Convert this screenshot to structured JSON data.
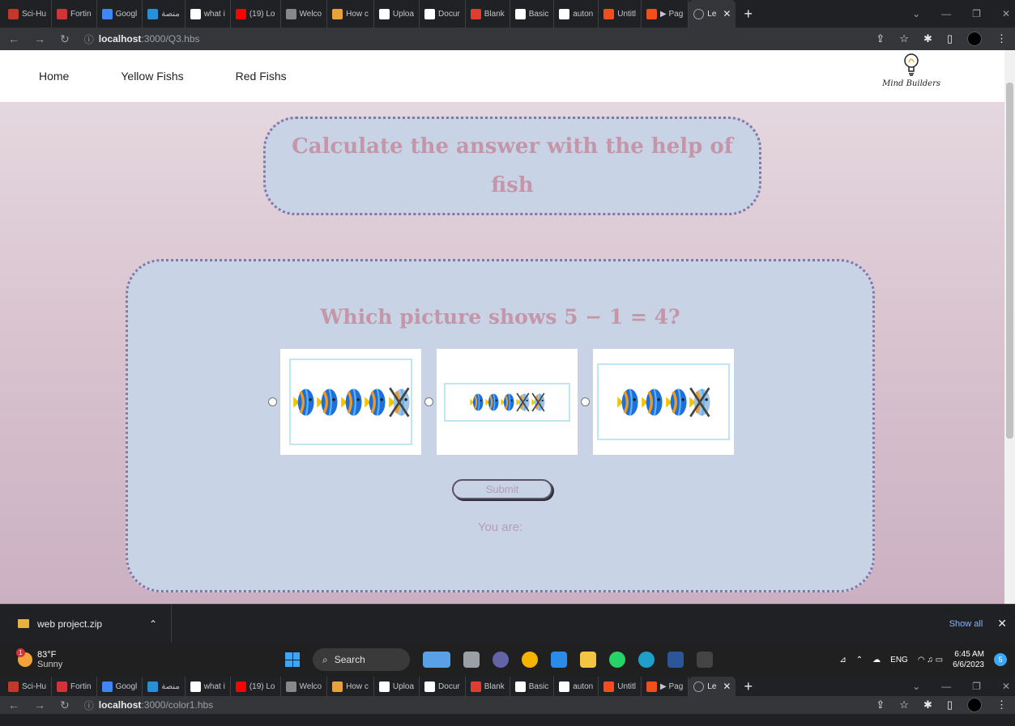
{
  "browser": {
    "tabs": [
      {
        "label": "Sci-Hu",
        "color": "#c0392b"
      },
      {
        "label": "Fortin",
        "color": "#d13438"
      },
      {
        "label": "Googl",
        "color": "#4285f4"
      },
      {
        "label": "منصة",
        "color": "#2b8fd6"
      },
      {
        "label": "what i",
        "color": "#ffffff"
      },
      {
        "label": "(19) Lo",
        "color": "#ff0000"
      },
      {
        "label": "Welco",
        "color": "#888888"
      },
      {
        "label": "How c",
        "color": "#e6a23c"
      },
      {
        "label": "Uploa",
        "color": "#ffffff"
      },
      {
        "label": "Docur",
        "color": "#ffffff"
      },
      {
        "label": "Blank",
        "color": "#e03c31"
      },
      {
        "label": "Basic",
        "color": "#ffffff"
      },
      {
        "label": "auton",
        "color": "#ffffff"
      },
      {
        "label": "Untitl",
        "color": "#f24e1e"
      },
      {
        "label": "▶ Pag",
        "color": "#f24e1e"
      }
    ],
    "active_tab": "Le",
    "url_host": "localhost",
    "url_path": ":3000/Q3.hbs",
    "url2_path": ":3000/color1.hbs"
  },
  "nav": {
    "links": [
      "Home",
      "Yellow Fishs",
      "Red Fishs"
    ],
    "logo_text": "Mind Builders"
  },
  "page": {
    "title": "Calculate the answer with the help of fish",
    "question": "Which picture shows 5 − 1 = 4?",
    "options": [
      {
        "fish": 5,
        "crossed": 1
      },
      {
        "fish": 5,
        "crossed": 2
      },
      {
        "fish": 4,
        "crossed": 1
      }
    ],
    "submit_label": "Submit",
    "result_label": "You are:"
  },
  "downloads": {
    "file": "web project.zip",
    "show_all": "Show all"
  },
  "taskbar": {
    "temp": "83°F",
    "weather": "Sunny",
    "weather_badge": "1",
    "search": "Search",
    "lang": "ENG",
    "time": "6:45 AM",
    "date": "6/6/2023",
    "notifications": "5"
  },
  "colors": {
    "title_text": "#c496a8",
    "box_bg": "#c9d3e6",
    "dotted_border": "#8a74a6"
  }
}
